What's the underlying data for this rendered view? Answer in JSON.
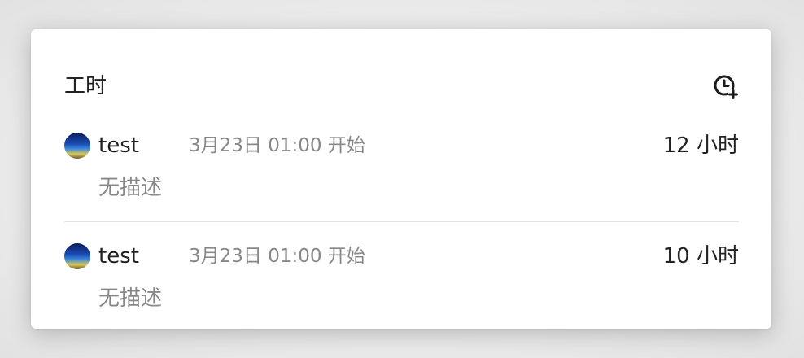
{
  "panel": {
    "title": "工时",
    "add_icon": "clock-plus-icon"
  },
  "entries": [
    {
      "user": "test",
      "start": "3月23日 01:00 开始",
      "duration": "12 小时",
      "description": "无描述"
    },
    {
      "user": "test",
      "start": "3月23日 01:00 开始",
      "duration": "10 小时",
      "description": "无描述"
    }
  ]
}
